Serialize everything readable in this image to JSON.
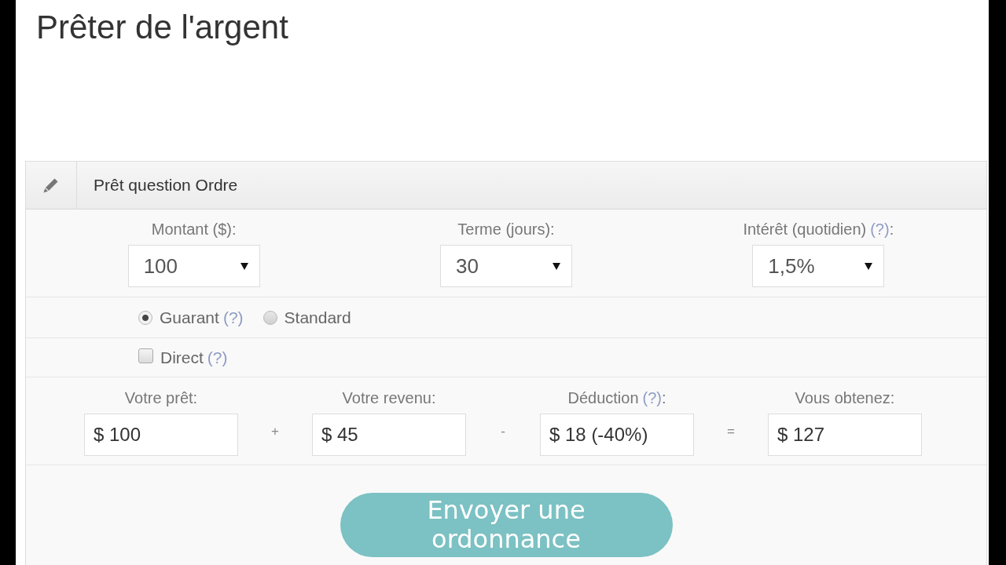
{
  "page": {
    "title": "Prêter de l'argent"
  },
  "panel": {
    "title": "Prêt question Ordre"
  },
  "selects": [
    {
      "label": "Montant ($):",
      "value": "100"
    },
    {
      "label": "Terme (jours):",
      "value": "30"
    },
    {
      "label": "Intérêt (quotidien)",
      "help": "(?)",
      "label_end": ":",
      "value": "1,5%"
    }
  ],
  "loan_types": [
    {
      "label": "Guarant",
      "help": "(?)",
      "selected": true
    },
    {
      "label": "Standard",
      "selected": false
    }
  ],
  "direct": {
    "label": "Direct",
    "help": "(?)",
    "checked": false
  },
  "summary": [
    {
      "label": "Votre prêt:",
      "value": "$ 100"
    },
    {
      "operator": "+",
      "label": "Votre revenu:",
      "value": "$ 45"
    },
    {
      "operator": "-",
      "label": "Déduction",
      "help": "(?)",
      "label_end": ":",
      "value": "$ 18 (-40%)"
    },
    {
      "operator": "=",
      "label": "Vous obtenez:",
      "value": "$ 127"
    }
  ],
  "submit": {
    "label": "Envoyer une ordonnance"
  }
}
